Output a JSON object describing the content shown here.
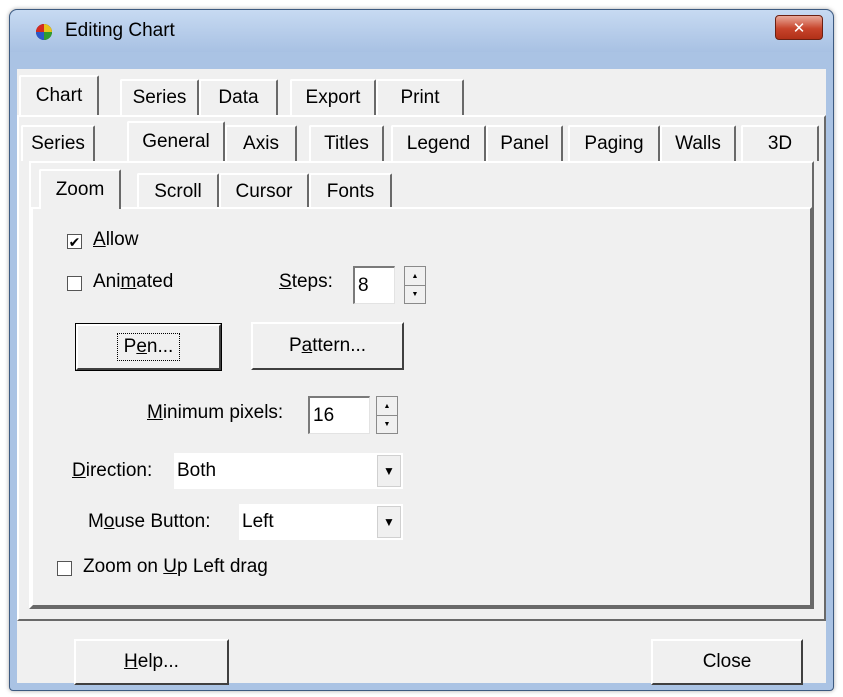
{
  "window": {
    "title": "Editing Chart",
    "close_glyph": "✕"
  },
  "main_tabs": [
    "Chart",
    "Series",
    "Data",
    "Export",
    "Print"
  ],
  "chart_tabs": [
    "Series",
    "General",
    "Axis",
    "Titles",
    "Legend",
    "Panel",
    "Paging",
    "Walls",
    "3D"
  ],
  "general_tabs": [
    "Zoom",
    "Scroll",
    "Cursor",
    "Fonts"
  ],
  "zoom": {
    "allow": {
      "pre": "",
      "key": "A",
      "post": "llow",
      "checked": true
    },
    "animated": {
      "pre": "Ani",
      "key": "m",
      "post": "ated",
      "checked": false
    },
    "steps": {
      "pre": "",
      "key": "S",
      "post": "teps:",
      "value": "8"
    },
    "pen_button": {
      "pre": "P",
      "key": "e",
      "post": "n..."
    },
    "pattern_button": {
      "pre": "P",
      "key": "a",
      "post": "ttern..."
    },
    "minimum_pixels": {
      "pre": "",
      "key": "M",
      "post": "inimum pixels:",
      "value": "16"
    },
    "direction": {
      "pre": "",
      "key": "D",
      "post": "irection:",
      "value": "Both"
    },
    "mouse_button": {
      "pre": "M",
      "key": "o",
      "post": "use Button:",
      "value": "Left"
    },
    "zoom_on_up": {
      "pre": "Zoom on ",
      "key": "U",
      "post": "p Left drag",
      "checked": false
    }
  },
  "footer": {
    "help": {
      "pre": "",
      "key": "H",
      "post": "elp..."
    },
    "close": "Close"
  },
  "colors": {
    "title_bar": "#a8c1e3",
    "close_button": "#c7442b",
    "dialog_face": "#f0f0f0"
  },
  "icons": {
    "app": "chart-ball-icon",
    "checked": "✔",
    "spin_up": "▲",
    "spin_down": "▼",
    "dropdown": "▼"
  }
}
